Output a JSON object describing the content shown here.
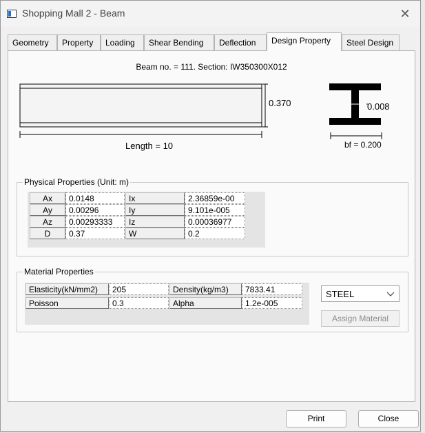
{
  "window": {
    "title": "Shopping Mall 2 - Beam",
    "close_glyph": "✕"
  },
  "tabs": [
    {
      "label": "Geometry"
    },
    {
      "label": "Property"
    },
    {
      "label": "Loading"
    },
    {
      "label": "Shear Bending"
    },
    {
      "label": "Deflection"
    },
    {
      "label": "Design Property",
      "active": true
    },
    {
      "label": "Steel Design"
    }
  ],
  "diagram": {
    "beam_info": "Beam no. = 111. Section: IW350300X012",
    "length_label": "Length = 10",
    "depth_label": "0.370",
    "web_thickness_label": "0.008",
    "flange_width_label": "bf = 0.200"
  },
  "physical": {
    "legend": "Physical Properties (Unit: m)",
    "rows": [
      {
        "k1": "Ax",
        "v1": "0.0148",
        "k2": "Ix",
        "v2": "2.36859e-00"
      },
      {
        "k1": "Ay",
        "v1": "0.00296",
        "k2": "Iy",
        "v2": "9.101e-005"
      },
      {
        "k1": "Az",
        "v1": "0.00293333",
        "k2": "Iz",
        "v2": "0.00036977"
      },
      {
        "k1": "D",
        "v1": "0.37",
        "k2": "W",
        "v2": "0.2"
      }
    ]
  },
  "material": {
    "legend": "Material Properties",
    "rows": [
      {
        "k1": "Elasticity(kN/mm2)",
        "v1": "205",
        "k2": "Density(kg/m3)",
        "v2": "7833.41"
      },
      {
        "k1": "Poisson",
        "v1": "0.3",
        "k2": "Alpha",
        "v2": "1.2e-005"
      }
    ],
    "material_select": "STEEL",
    "assign_button": "Assign Material"
  },
  "footer": {
    "print": "Print",
    "close": "Close"
  }
}
